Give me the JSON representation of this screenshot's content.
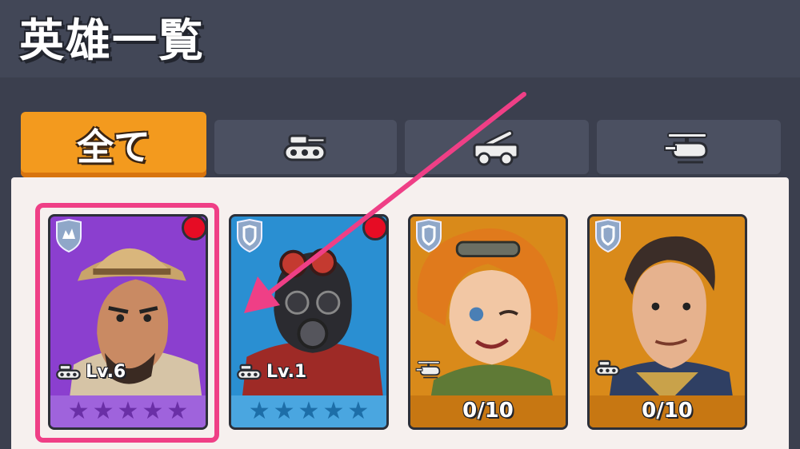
{
  "header": {
    "title": "英雄一覧"
  },
  "tabs": [
    {
      "label": "全て",
      "icon": "all-label",
      "active": true
    },
    {
      "label": "",
      "icon": "tank-icon",
      "active": false
    },
    {
      "label": "",
      "icon": "artillery-truck-icon",
      "active": false
    },
    {
      "label": "",
      "icon": "helicopter-icon",
      "active": false
    }
  ],
  "heroes": [
    {
      "level": "Lv.6",
      "unit_type": "tank",
      "class_badge": "assault",
      "stars": 0,
      "max_stars": 5,
      "notification": true,
      "owned": true,
      "color": "#8b3fcf"
    },
    {
      "level": "Lv.1",
      "unit_type": "tank",
      "class_badge": "defense",
      "stars": 0,
      "max_stars": 5,
      "notification": true,
      "owned": true,
      "color": "#2a8fd2"
    },
    {
      "shards": "0/10",
      "unit_type": "helicopter",
      "class_badge": "defense",
      "owned": false,
      "color": "#d98a1a"
    },
    {
      "shards": "0/10",
      "unit_type": "tank",
      "class_badge": "defense",
      "owned": false,
      "color": "#d98a1a"
    }
  ],
  "annotation": {
    "highlight_color": "#ef3f86"
  }
}
